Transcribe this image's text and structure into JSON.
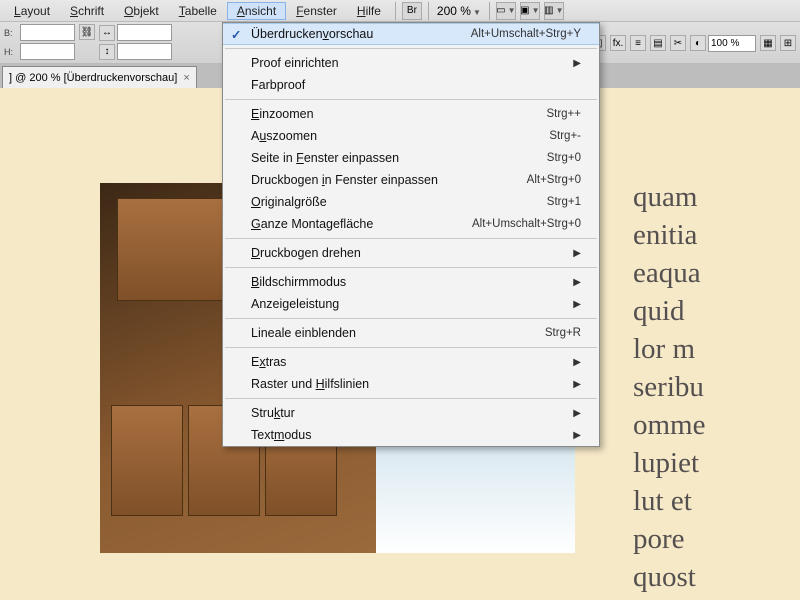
{
  "menubar": {
    "items": [
      "Layout",
      "Schrift",
      "Objekt",
      "Tabelle",
      "Ansicht",
      "Fenster",
      "Hilfe"
    ],
    "activeIndex": 4,
    "br_label": "Br",
    "zoom": "200 %"
  },
  "control_strip": {
    "B_label": "B:",
    "H_label": "H:",
    "pct": "100 %"
  },
  "doc_tab": {
    "title": "] @ 200 % [Überdruckenvorschau]"
  },
  "dropdown": {
    "groups": [
      [
        {
          "label": "Überdrucken<u>v</u>orschau",
          "shortcut": "Alt+Umschalt+Strg+Y",
          "checked": true,
          "highlighted": true
        }
      ],
      [
        {
          "label": "Proof einrichten",
          "submenu": true
        },
        {
          "label": "Farbproof"
        }
      ],
      [
        {
          "label": "<u>E</u>inzoomen",
          "shortcut": "Strg++"
        },
        {
          "label": "A<u>u</u>szoomen",
          "shortcut": "Strg+-"
        },
        {
          "label": "Seite in <u>F</u>enster einpassen",
          "shortcut": "Strg+0"
        },
        {
          "label": "Druckbogen <u>i</u>n Fenster einpassen",
          "shortcut": "Alt+Strg+0"
        },
        {
          "label": "<u>O</u>riginalgröße",
          "shortcut": "Strg+1"
        },
        {
          "label": "<u>G</u>anze Montagefläche",
          "shortcut": "Alt+Umschalt+Strg+0"
        }
      ],
      [
        {
          "label": "<u>D</u>ruckbogen drehen",
          "submenu": true
        }
      ],
      [
        {
          "label": "<u>B</u>ildschirmmodus",
          "submenu": true
        },
        {
          "label": "Anzeigeleistung",
          "submenu": true
        }
      ],
      [
        {
          "label": "Lineale einblenden",
          "shortcut": "Strg+R"
        }
      ],
      [
        {
          "label": "E<u>x</u>tras",
          "submenu": true
        },
        {
          "label": "Raster und <u>H</u>ilfslinien",
          "submenu": true
        }
      ],
      [
        {
          "label": "Stru<u>k</u>tur",
          "submenu": true
        },
        {
          "label": "Text<u>m</u>odus",
          "submenu": true
        }
      ]
    ]
  },
  "body_text": "quam\nenitia\neaqua\nquid\nlor m\nseribu\nomme\nlupiet\nlut et\npore\nquost"
}
